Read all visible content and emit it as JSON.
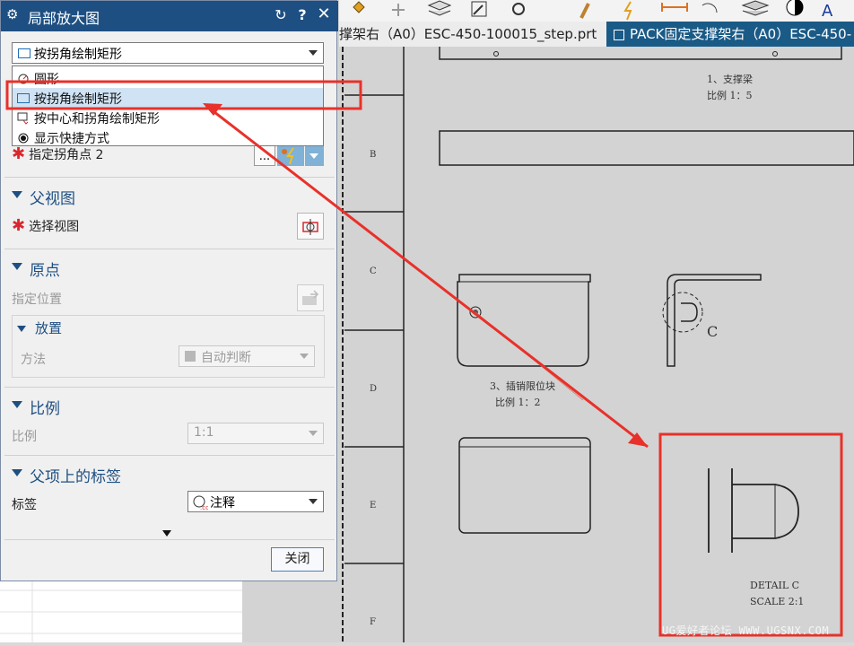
{
  "dialog": {
    "title": "局部放大图",
    "type_combo": {
      "value": "按拐角绘制矩形"
    },
    "dropdown_items": [
      {
        "label": "圆形",
        "icon": "circle-icon"
      },
      {
        "label": "按拐角绘制矩形",
        "icon": "rectangle-icon",
        "selected": true
      },
      {
        "label": "按中心和拐角绘制矩形",
        "icon": "center-rectangle-icon"
      },
      {
        "label": "显示快捷方式",
        "icon": "eye-icon"
      }
    ],
    "corner_point_2": "指定拐角点 2",
    "corner_dots": "...",
    "parent_view": {
      "heading": "父视图",
      "select_view": "选择视图"
    },
    "origin": {
      "heading": "原点",
      "specify_position": "指定位置",
      "placement": {
        "heading": "放置",
        "method_label": "方法",
        "method_value": "自动判断"
      }
    },
    "scale": {
      "heading": "比例",
      "label": "比例",
      "value": "1:1"
    },
    "parent_label": {
      "heading": "父项上的标签",
      "label": "标签",
      "value": "注释"
    },
    "close_button": "关闭"
  },
  "tabs": [
    {
      "label": "撑架右（A0）ESC-450-100015_step.prt",
      "active": false
    },
    {
      "label": "PACK固定支撑架右（A0）ESC-450-",
      "active": true
    }
  ],
  "drawing": {
    "zones": [
      "B",
      "C",
      "D",
      "E",
      "F"
    ],
    "caption_1_title": "1、支撑梁",
    "caption_1_scale": "比例 1：5",
    "caption_3_title": "3、插销限位块",
    "caption_3_scale": "比例 1：2",
    "detail_letter": "C",
    "detail_title": "DETAIL C",
    "detail_scale": "SCALE 2:1"
  },
  "watermark": "UG爱好者论坛 WWW.UGSNX.COM",
  "colors": {
    "title_bar": "#1e4f82",
    "highlight": "#e8312a",
    "tab_active": "#1a5a86"
  }
}
